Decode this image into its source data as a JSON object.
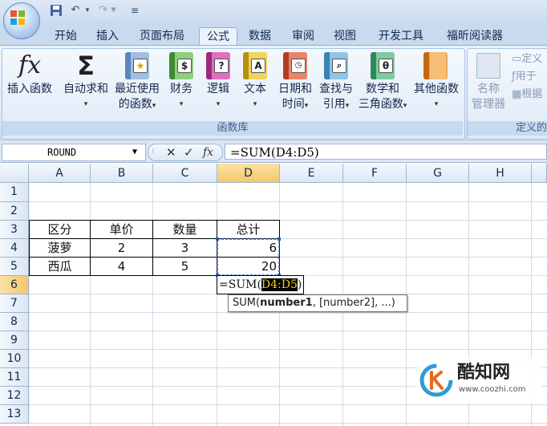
{
  "quick_access": {
    "undo_icon": "undo-icon",
    "redo_icon": "redo-icon",
    "dropdown": "▾"
  },
  "tabs": [
    "开始",
    "插入",
    "页面布局",
    "公式",
    "数据",
    "审阅",
    "视图",
    "开发工具",
    "福昕阅读器"
  ],
  "active_tab": "公式",
  "ribbon": {
    "insert_function": "插入函数",
    "autosum": "自动求和",
    "recent_line1": "最近使用",
    "recent_line2": "的函数",
    "financial": "财务",
    "logical": "逻辑",
    "text": "文本",
    "datetime_line1": "日期和",
    "datetime_line2": "时间",
    "lookup_line1": "查找与",
    "lookup_line2": "引用",
    "math_line1": "数学和",
    "math_line2": "三角函数",
    "other": "其他函数",
    "group_label": "函数库",
    "name_manager_line1": "名称",
    "name_manager_line2": "管理器",
    "define_name": "定义",
    "use_in_formula": "用于",
    "create_from_selection": "根据",
    "defined_names_label": "定义的",
    "fx_symbol": "fx",
    "sigma_symbol": "Σ"
  },
  "formula_bar": {
    "name_box": "ROUND",
    "formula": "=SUM(D4:D5)",
    "cancel": "✕",
    "enter": "✓",
    "fx": "fx"
  },
  "columns": [
    "A",
    "B",
    "C",
    "D",
    "E",
    "F",
    "G",
    "H"
  ],
  "rows": [
    "1",
    "2",
    "3",
    "4",
    "5",
    "6",
    "7",
    "8",
    "9",
    "10",
    "11",
    "12",
    "13"
  ],
  "cells": {
    "A3": "区分",
    "B3": "单价",
    "C3": "数量",
    "D3": "总计",
    "A4": "菠萝",
    "B4": "2",
    "C4": "3",
    "D4": "6",
    "A5": "西瓜",
    "B5": "4",
    "C5": "5",
    "D5": "20",
    "D6_prefix": "=SUM(",
    "D6_range": "D4:D5",
    "D6_suffix": ")"
  },
  "tooltip": {
    "fn": "SUM(",
    "arg1": "number1",
    "rest": ", [number2], ...)"
  },
  "watermark": {
    "brand": "酷知网",
    "url": "www.coozhi.com"
  }
}
